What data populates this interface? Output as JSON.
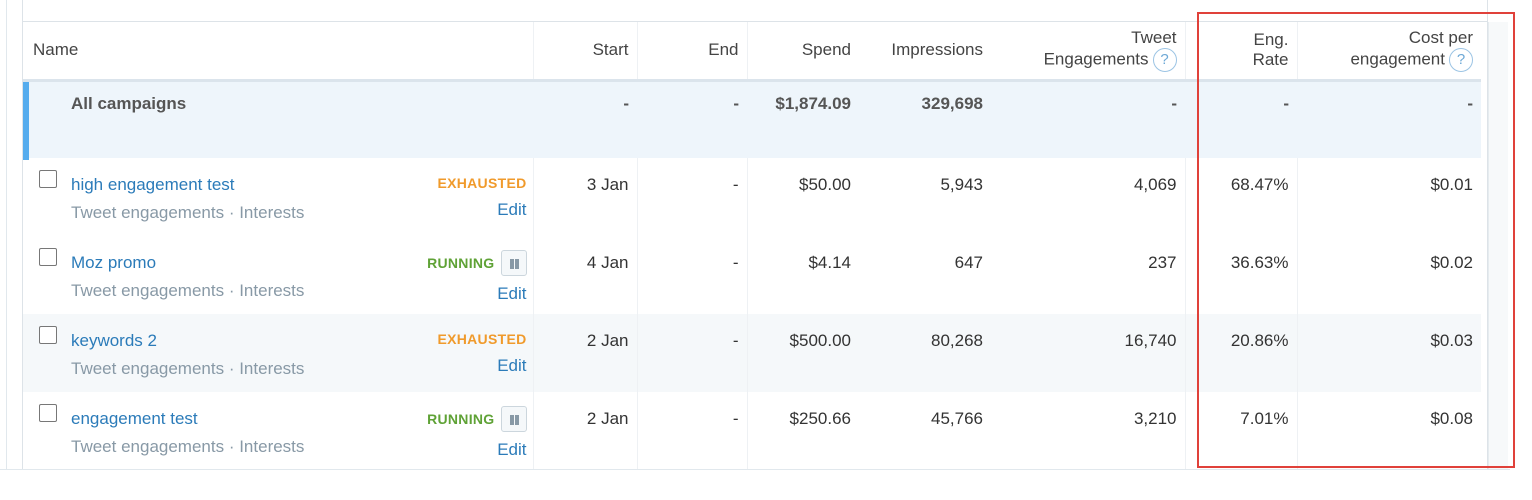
{
  "columns": {
    "name": "Name",
    "start": "Start",
    "end": "End",
    "spend": "Spend",
    "impressions": "Impressions",
    "tweet_engagements_l1": "Tweet",
    "tweet_engagements_l2": "Engagements",
    "eng_rate_l1": "Eng.",
    "eng_rate_l2": "Rate",
    "cpe_l1": "Cost per",
    "cpe_l2": "engagement",
    "help_glyph": "?"
  },
  "summary": {
    "label": "All campaigns",
    "start": "-",
    "end": "-",
    "spend": "$1,874.09",
    "impressions": "329,698",
    "tweet_engagements": "-",
    "eng_rate": "-",
    "cost_per_engagement": "-"
  },
  "campaigns": [
    {
      "name": "high engagement test",
      "sub": "Tweet engagements · Interests",
      "status": "EXHAUSTED",
      "edit": "Edit",
      "start": "3 Jan",
      "end": "-",
      "spend": "$50.00",
      "impressions": "5,943",
      "tweet_engagements": "4,069",
      "eng_rate": "68.47%",
      "cost_per_engagement": "$0.01"
    },
    {
      "name": "Moz promo",
      "sub": "Tweet engagements · Interests",
      "status": "RUNNING",
      "edit": "Edit",
      "start": "4 Jan",
      "end": "-",
      "spend": "$4.14",
      "impressions": "647",
      "tweet_engagements": "237",
      "eng_rate": "36.63%",
      "cost_per_engagement": "$0.02"
    },
    {
      "name": "keywords 2",
      "sub": "Tweet engagements · Interests",
      "status": "EXHAUSTED",
      "edit": "Edit",
      "start": "2 Jan",
      "end": "-",
      "spend": "$500.00",
      "impressions": "80,268",
      "tweet_engagements": "16,740",
      "eng_rate": "20.86%",
      "cost_per_engagement": "$0.03"
    },
    {
      "name": "engagement test",
      "sub": "Tweet engagements · Interests",
      "status": "RUNNING",
      "edit": "Edit",
      "start": "2 Jan",
      "end": "-",
      "spend": "$250.66",
      "impressions": "45,766",
      "tweet_engagements": "3,210",
      "eng_rate": "7.01%",
      "cost_per_engagement": "$0.08"
    }
  ],
  "colors": {
    "link": "#2b7bb9",
    "exhausted": "#f09a2b",
    "running": "#5fa236",
    "summary_accent": "#55acee",
    "highlight": "#e0413a"
  },
  "icons": {
    "help": "help-icon",
    "pause": "pause-icon",
    "checkbox": "checkbox"
  }
}
